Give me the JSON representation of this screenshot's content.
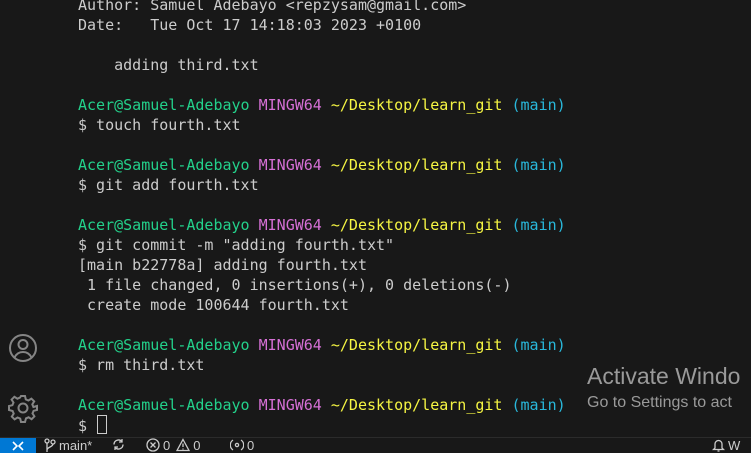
{
  "terminal": {
    "lines": [
      {
        "type": "text",
        "text": "Author: Samuel Adebayo <repzysam@gmail.com>"
      },
      {
        "type": "text",
        "text": "Date:   Tue Oct 17 14:18:03 2023 +0100"
      },
      {
        "type": "blank"
      },
      {
        "type": "text",
        "text": "    adding third.txt"
      },
      {
        "type": "blank"
      },
      {
        "type": "prompt"
      },
      {
        "type": "cmd",
        "text": "$ touch fourth.txt"
      },
      {
        "type": "blank"
      },
      {
        "type": "prompt"
      },
      {
        "type": "cmd",
        "text": "$ git add fourth.txt"
      },
      {
        "type": "blank"
      },
      {
        "type": "prompt"
      },
      {
        "type": "cmd",
        "text": "$ git commit -m \"adding fourth.txt\""
      },
      {
        "type": "text",
        "text": "[main b22778a] adding fourth.txt"
      },
      {
        "type": "text",
        "text": " 1 file changed, 0 insertions(+), 0 deletions(-)"
      },
      {
        "type": "text",
        "text": " create mode 100644 fourth.txt"
      },
      {
        "type": "blank"
      },
      {
        "type": "prompt"
      },
      {
        "type": "cmd",
        "text": "$ rm third.txt"
      },
      {
        "type": "blank"
      },
      {
        "type": "prompt"
      },
      {
        "type": "input",
        "text": "$ "
      }
    ],
    "prompt": {
      "user": "Acer@Samuel-Adebayo",
      "system": "MINGW64",
      "path": "~/Desktop/learn_git",
      "branch": "(main)"
    }
  },
  "watermark": {
    "title": "Activate Windo",
    "subtitle": "Go to Settings to act"
  },
  "statusbar": {
    "branch": "main*",
    "errors": "0",
    "warnings": "0",
    "ports": "0",
    "right_fragment": "W"
  },
  "colors": {
    "user": "#23d18b",
    "system": "#d670d6",
    "path": "#f5f543",
    "branch": "#29b8db",
    "remote_accent": "#0078d4"
  },
  "icons": {
    "activity": [
      "account-icon",
      "gear-icon"
    ],
    "statusbar": [
      "remote-icon",
      "source-control-icon",
      "sync-icon",
      "error-icon",
      "warning-icon",
      "ports-icon",
      "bell-icon"
    ]
  }
}
